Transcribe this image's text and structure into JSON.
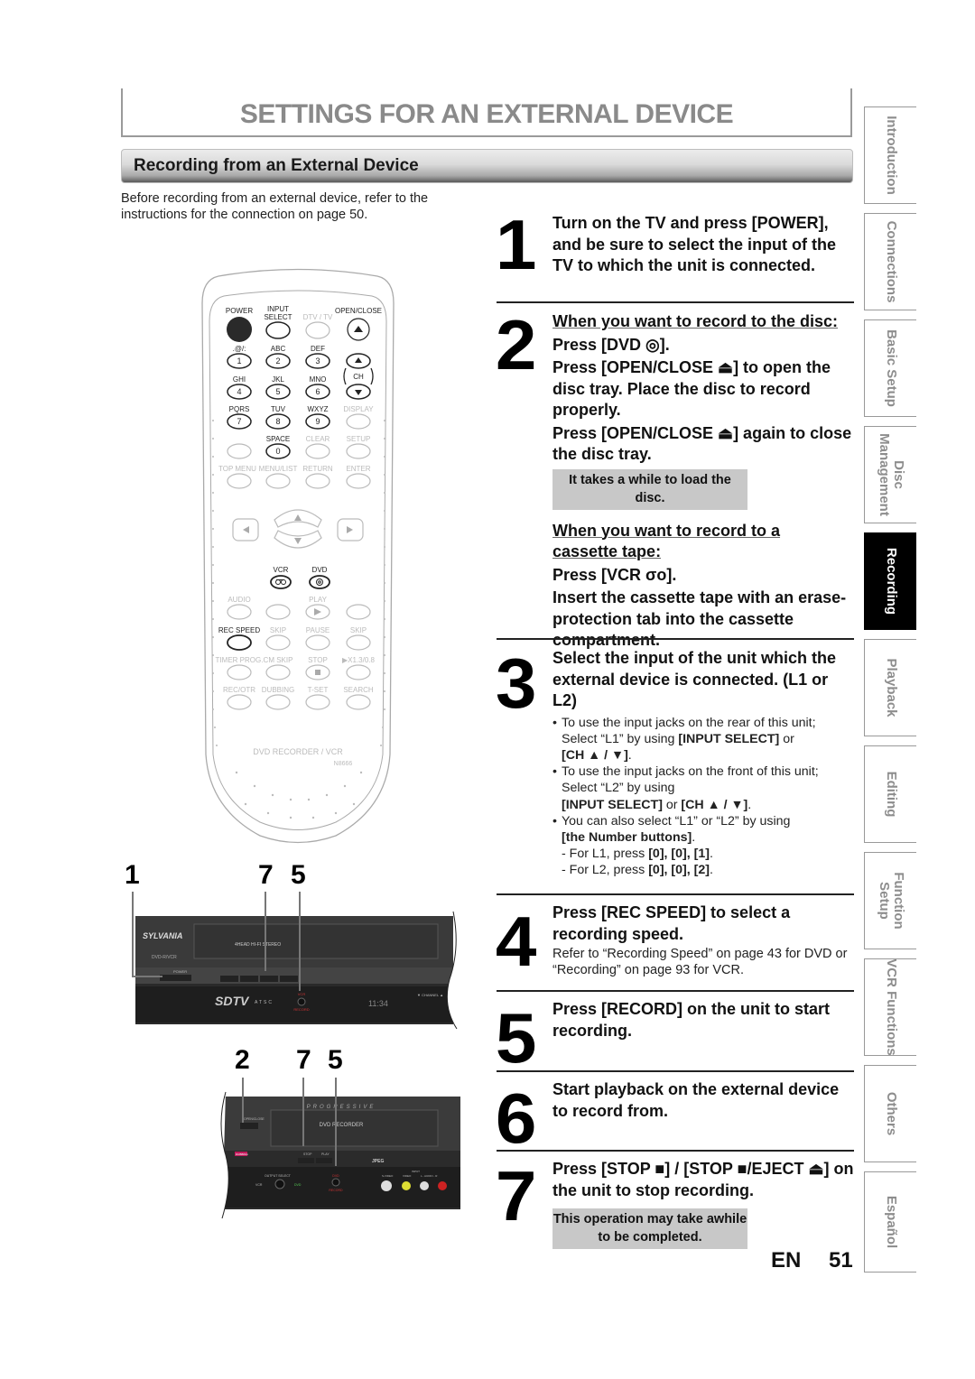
{
  "page": {
    "title": "SETTINGS FOR AN EXTERNAL DEVICE",
    "section_title": "Recording from an External Device",
    "intro": "Before recording from an external device, refer to the instructions for the connection on page 50.",
    "language": "EN",
    "page_number": "51"
  },
  "remote": {
    "model": "DVD RECORDER / VCR",
    "code": "N8666",
    "row1": {
      "power": "POWER",
      "input_select": "INPUT SELECT",
      "dtv_tv": "DTV / TV",
      "open_close": "OPEN/CLOSE"
    },
    "number_labels": [
      ".@/:",
      "ABC",
      "DEF",
      "GHI",
      "JKL",
      "MNO",
      "PQRS",
      "TUV",
      "WXYZ"
    ],
    "numbers": [
      "1",
      "2",
      "3",
      "4",
      "5",
      "6",
      "7",
      "8",
      "9"
    ],
    "ch": "CH",
    "display": "DISPLAY",
    "space": "SPACE",
    "zero": "0",
    "clear": "CLEAR",
    "setup": "SETUP",
    "menu_row": [
      "TOP MENU",
      "MENU/LIST",
      "RETURN",
      "ENTER"
    ],
    "vcr": "VCR",
    "dvd": "DVD",
    "transport_labels_1": [
      "AUDIO",
      "",
      "PLAY",
      ""
    ],
    "transport_labels_2": [
      "REC SPEED",
      "SKIP",
      "PAUSE",
      "SKIP"
    ],
    "transport_labels_3": [
      "TIMER PROG.",
      "CM SKIP",
      "STOP",
      "▶X1.3/0.8"
    ],
    "transport_labels_4": [
      "REC/OTR",
      "DUBBING",
      "T-SET",
      "SEARCH"
    ]
  },
  "vcr_unit": {
    "callouts": [
      "1",
      "7",
      "5"
    ],
    "brand": "SYLVANIA",
    "model": "DVD-R/VCR",
    "cassette_label": "4HEAD HI-FI STEREO",
    "power": "POWER",
    "buttons": [
      "REW",
      "F.FWD",
      "STOP/EJECT",
      "PLAY"
    ],
    "sdtv": "SDTV",
    "atsc": "ATSC",
    "record_top": "VCR",
    "record_bottom": "RECORD",
    "clock": "11:34",
    "channel": "▼ CHANNEL ▲"
  },
  "dvd_unit": {
    "callouts": [
      "2",
      "7",
      "5"
    ],
    "progressive": "PROGRESSIVE",
    "open_close": "OPEN/CLOSE",
    "recorder_label": "DVD RECORDER",
    "dubbing": "DUBBING",
    "stop": "STOP",
    "play": "PLAY",
    "jpeg": "JPEG",
    "output_select": "OUTPUT SELECT",
    "vcr_out": "VCR",
    "dvd_out": "DVD",
    "record_top": "DVD",
    "record_bottom": "RECORD",
    "input_label": "INPUT",
    "jacks": [
      "S-VIDEO",
      "VIDEO",
      "L - AUDIO - R"
    ]
  },
  "steps": [
    {
      "num": "1",
      "heading": "Turn on the TV and press [POWER], and be sure to select the input of the TV to which the unit is connected."
    },
    {
      "num": "2",
      "disc_heading": "When you want to record to the disc:",
      "disc_press": "Press [DVD ◎].",
      "disc_open": "Press [OPEN/CLOSE ⏏] to open the disc tray. Place the disc to record properly.",
      "disc_close": "Press [OPEN/CLOSE ⏏] again to close the disc tray.",
      "disc_note": "It takes a while to load the disc.",
      "tape_heading_1": "When you want to record to a",
      "tape_heading_2": "cassette tape:",
      "tape_press": "Press [VCR σο].",
      "tape_insert": "Insert the cassette tape with an erase-protection tab into the cassette compartment."
    },
    {
      "num": "3",
      "heading": "Select the input of the unit which the external device is connected. (L1 or L2)",
      "b1_a": "To use the input jacks on the rear of this unit; Select “L1” by using ",
      "b1_b": "[INPUT SELECT]",
      "b1_c": " or ",
      "b1_d": "[CH ▲ / ▼]",
      "b1_e": ".",
      "b2_a": "To use the input jacks on the front of this unit; Select “L2” by using ",
      "b2_b": "[INPUT SELECT]",
      "b2_c": " or ",
      "b2_d": "[CH ▲ / ▼]",
      "b2_e": ".",
      "b3_a": "You can also select “L1” or “L2” by using ",
      "b3_b": "[the Number buttons]",
      "b3_c": ".",
      "l1_a": "- For L1, press ",
      "l1_keys": "[0], [0], [1]",
      "l2_a": "- For L2, press ",
      "l2_keys": "[0], [0], [2]",
      "period": "."
    },
    {
      "num": "4",
      "heading": "Press [REC SPEED] to select a recording speed.",
      "detail": "Refer to “Recording Speed” on page 43 for DVD or “Recording” on page 93 for VCR."
    },
    {
      "num": "5",
      "heading": "Press [RECORD] on the unit to start recording."
    },
    {
      "num": "6",
      "heading": "Start playback on the external device to record from."
    },
    {
      "num": "7",
      "heading": "Press [STOP ■] / [STOP ■/EJECT ⏏] on the unit to stop recording.",
      "note": "This operation may take awhile to be completed."
    }
  ],
  "side_tabs": [
    {
      "label": "Introduction",
      "active": false
    },
    {
      "label": "Connections",
      "active": false
    },
    {
      "label": "Basic Setup",
      "active": false
    },
    {
      "label": "Disc Management",
      "active": false
    },
    {
      "label": "Recording",
      "active": true
    },
    {
      "label": "Playback",
      "active": false
    },
    {
      "label": "Editing",
      "active": false
    },
    {
      "label": "Function Setup",
      "active": false
    },
    {
      "label": "VCR Functions",
      "active": false
    },
    {
      "label": "Others",
      "active": false
    },
    {
      "label": "Español",
      "active": false
    }
  ]
}
